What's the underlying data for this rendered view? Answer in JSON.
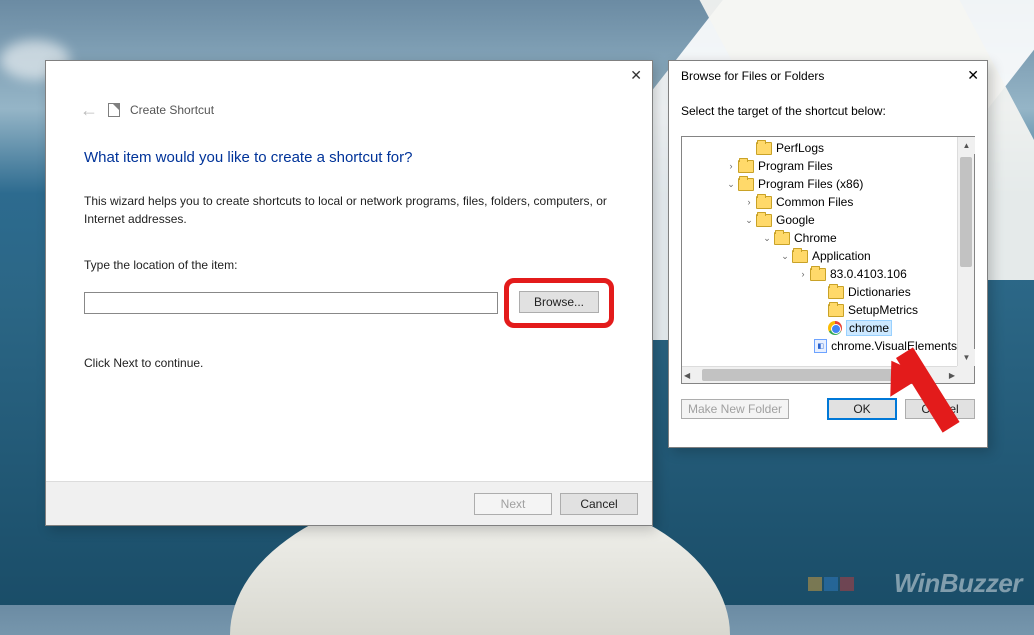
{
  "shortcut_dialog": {
    "title": "Create Shortcut",
    "heading": "What item would you like to create a shortcut for?",
    "helper": "This wizard helps you to create shortcuts to local or network programs, files, folders, computers, or Internet addresses.",
    "location_label": "Type the location of the item:",
    "location_value": "",
    "browse_btn": "Browse...",
    "continue_hint": "Click Next to continue.",
    "next_btn": "Next",
    "cancel_btn": "Cancel",
    "close_glyph": "✕"
  },
  "browse_dialog": {
    "title": "Browse for Files or Folders",
    "instruction": "Select the target of the shortcut below:",
    "make_folder_btn": "Make New Folder",
    "ok_btn": "OK",
    "cancel_btn": "Cancel",
    "close_glyph": "✕",
    "tree": [
      {
        "indent": 56,
        "caret": "",
        "icon": "folder",
        "label": "PerfLogs"
      },
      {
        "indent": 38,
        "caret": ">",
        "icon": "folder",
        "label": "Program Files"
      },
      {
        "indent": 38,
        "caret": "v",
        "icon": "folder",
        "label": "Program Files (x86)"
      },
      {
        "indent": 56,
        "caret": ">",
        "icon": "folder",
        "label": "Common Files"
      },
      {
        "indent": 56,
        "caret": "v",
        "icon": "folder",
        "label": "Google"
      },
      {
        "indent": 74,
        "caret": "v",
        "icon": "folder",
        "label": "Chrome"
      },
      {
        "indent": 92,
        "caret": "v",
        "icon": "folder",
        "label": "Application"
      },
      {
        "indent": 110,
        "caret": ">",
        "icon": "folder",
        "label": "83.0.4103.106"
      },
      {
        "indent": 128,
        "caret": "",
        "icon": "folder",
        "label": "Dictionaries"
      },
      {
        "indent": 128,
        "caret": "",
        "icon": "folder",
        "label": "SetupMetrics"
      },
      {
        "indent": 128,
        "caret": "",
        "icon": "chrome",
        "label": "chrome",
        "selected": true
      },
      {
        "indent": 128,
        "caret": "",
        "icon": "visual",
        "label": "chrome.VisualElements"
      }
    ]
  },
  "watermark": "WinBuzzer"
}
